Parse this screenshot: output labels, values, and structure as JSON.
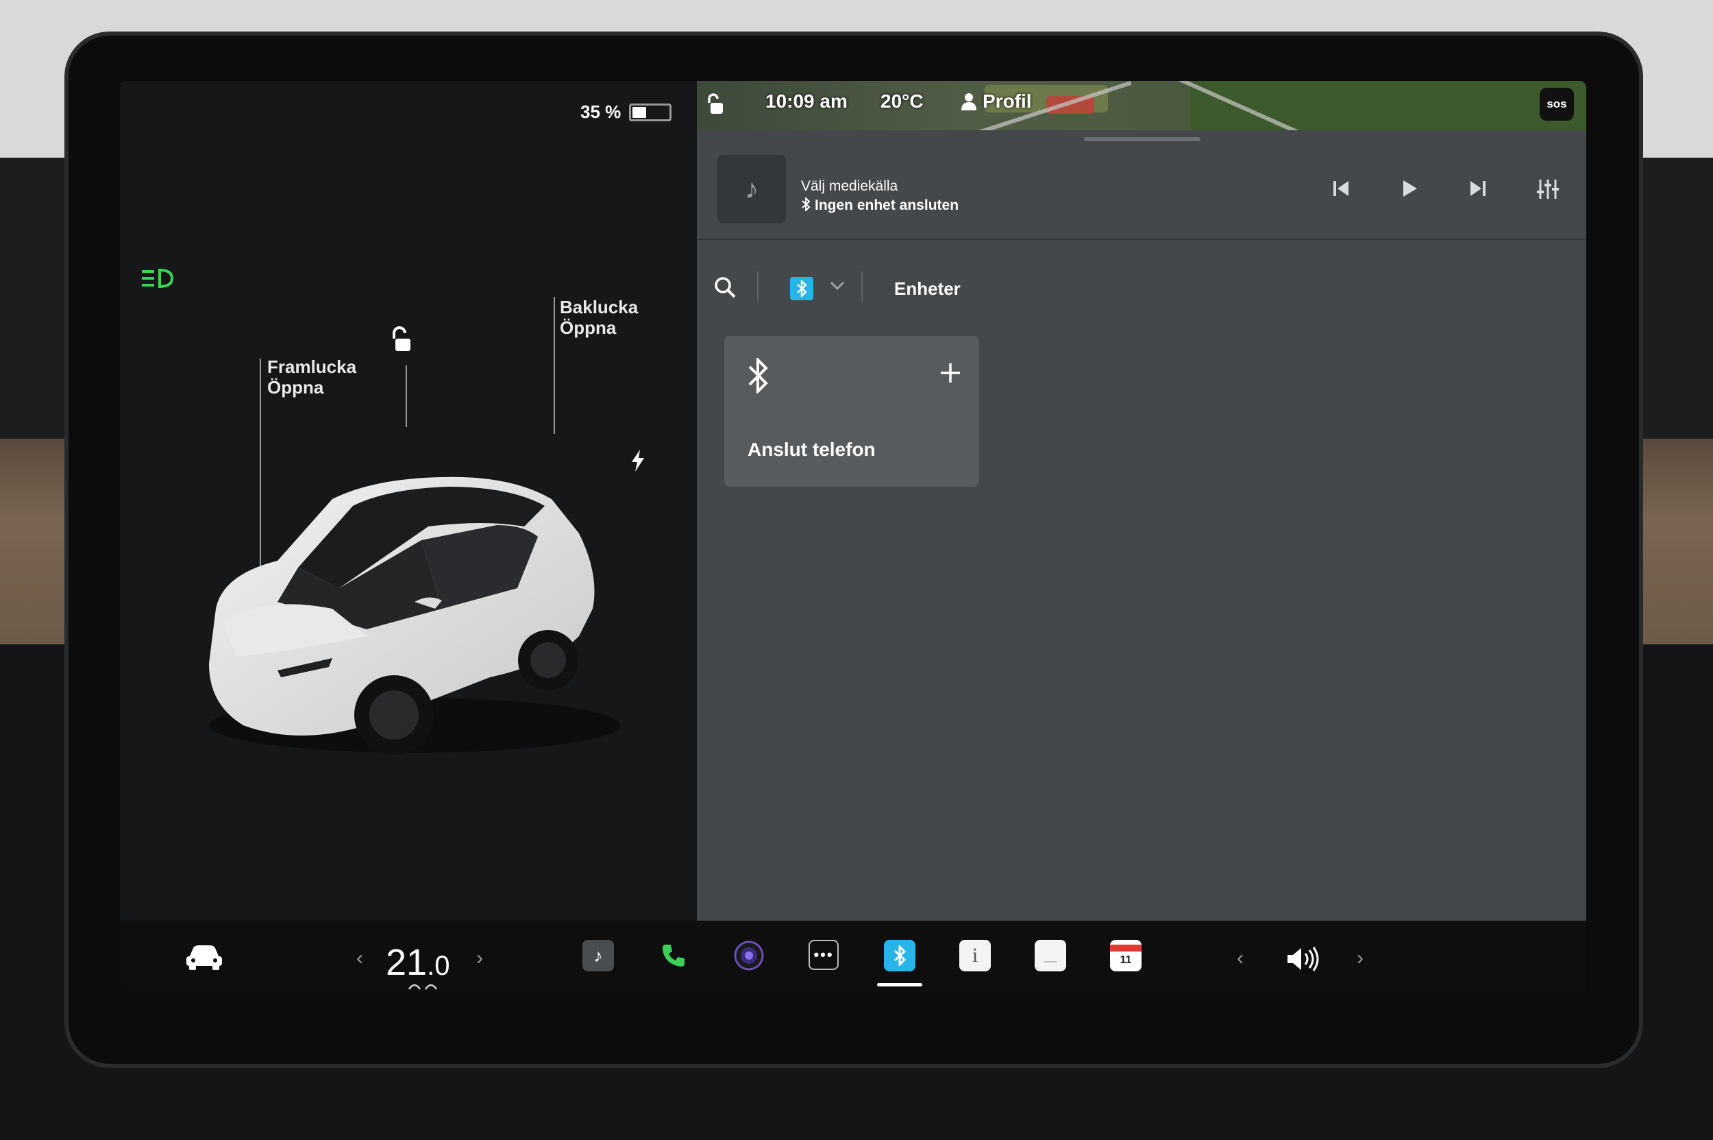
{
  "left": {
    "battery_text": "35 %",
    "battery_level": 0.35,
    "frunk_label": "Framlucka",
    "frunk_action": "Öppna",
    "trunk_label": "Baklucka",
    "trunk_action": "Öppna"
  },
  "statusbar": {
    "time": "10:09 am",
    "temperature": "20°C",
    "profile": "Profil",
    "sos": "sos"
  },
  "media": {
    "title": "Välj mediekälla",
    "subtitle": "Ingen enhet ansluten"
  },
  "toolbar": {
    "section_label": "Enheter"
  },
  "card": {
    "label": "Anslut telefon"
  },
  "dock": {
    "temp_whole": "21",
    "temp_decimal": ".0",
    "calendar_day": "11"
  },
  "colors": {
    "accent_bluetooth": "#26b4e9",
    "headlight_green": "#39d353",
    "panel_gray": "#45484b"
  }
}
